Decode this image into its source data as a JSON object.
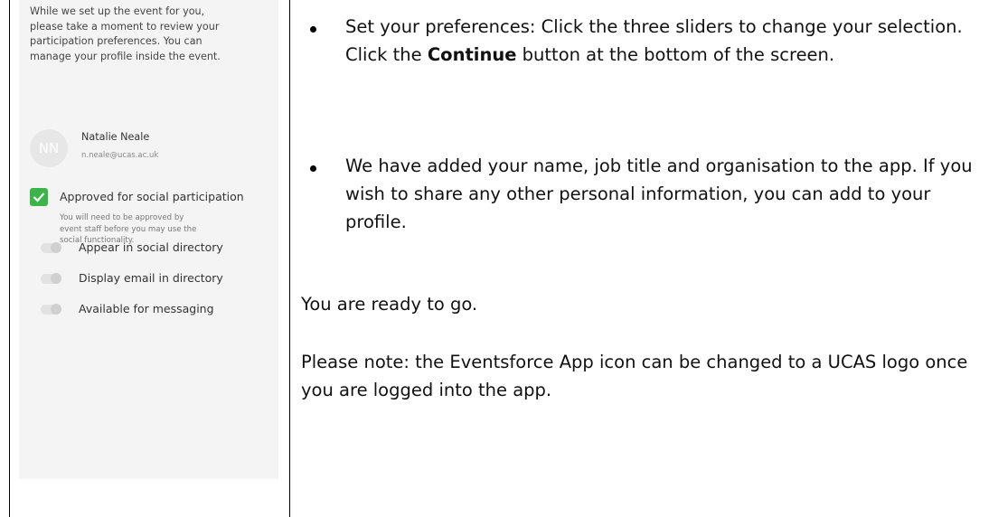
{
  "phone": {
    "intro": "While we set up the event for you,\nplease take a moment to review your\nparticipation preferences. You can\nmanage your profile inside the event.",
    "user": {
      "initials": "NN",
      "name": "Natalie Neale",
      "email": "n.neale@ucas.ac.uk"
    },
    "approval": {
      "checked": true,
      "label": "Approved for social participation",
      "note": "You will need to be approved by\nevent staff before you may use the\nsocial functionality."
    },
    "toggles": [
      {
        "label": "Appear in social directory",
        "on": false
      },
      {
        "label": "Display email in directory",
        "on": false
      },
      {
        "label": "Available for messaging",
        "on": false
      }
    ],
    "colors": {
      "check_green": "#3bb54a",
      "panel_bg": "#f4f4f4"
    }
  },
  "instructions": {
    "bullet1": {
      "before": "Set your preferences:  Click the three sliders to change your selection. Click the ",
      "bold": "Continue",
      "after": " button at the bottom of the screen."
    },
    "bullet2": "We have added your name, job title and organisation to the app. If you wish to share any other personal information, you can add to your profile.",
    "ready": "You are ready to go.",
    "note": "Please note: the Eventsforce App icon can be changed to a UCAS logo once you are logged into the app."
  }
}
